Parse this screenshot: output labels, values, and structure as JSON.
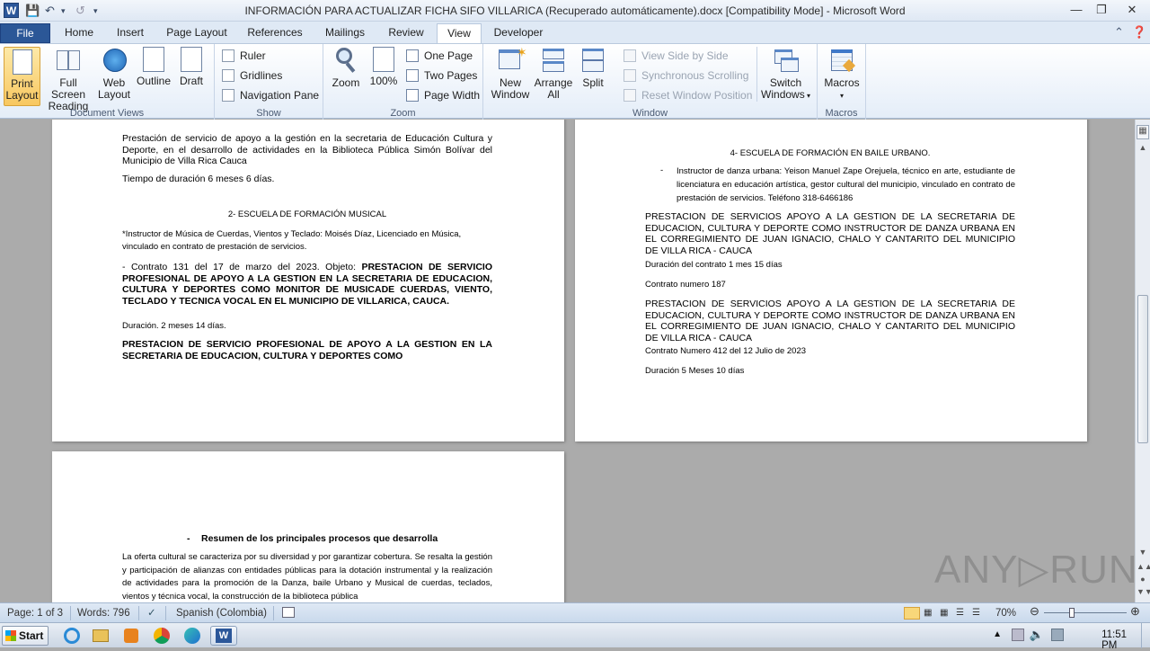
{
  "window": {
    "title": "INFORMACIÓN PARA ACTUALIZAR FICHA SIFO VILLARICA (Recuperado automáticamente).docx [Compatibility Mode] - Microsoft Word",
    "app_icon": "W"
  },
  "tabs": [
    "File",
    "Home",
    "Insert",
    "Page Layout",
    "References",
    "Mailings",
    "Review",
    "View",
    "Developer"
  ],
  "ribbon": {
    "document_views": {
      "label": "Document Views",
      "print_layout": "Print Layout",
      "full_screen_reading": "Full Screen Reading",
      "web_layout": "Web Layout",
      "outline": "Outline",
      "draft": "Draft"
    },
    "show": {
      "label": "Show",
      "ruler": "Ruler",
      "gridlines": "Gridlines",
      "navigation_pane": "Navigation Pane"
    },
    "zoom": {
      "label": "Zoom",
      "zoom": "Zoom",
      "hundred": "100%",
      "one_page": "One Page",
      "two_pages": "Two Pages",
      "page_width": "Page Width"
    },
    "window": {
      "label": "Window",
      "new_window": "New Window",
      "arrange_all": "Arrange All",
      "split": "Split",
      "view_side_by_side": "View Side by Side",
      "synchronous_scrolling": "Synchronous Scrolling",
      "reset_window_position": "Reset Window Position",
      "switch_windows": "Switch Windows"
    },
    "macros": {
      "label": "Macros",
      "macros": "Macros"
    }
  },
  "page1": {
    "p1": "Prestación de servicio de apoyo a la gestión en la secretaria de Educación Cultura y Deporte, en el desarrollo de actividades en la Biblioteca Pública Simón Bolívar del Municipio de Villa Rica Cauca",
    "p2": "Tiempo de duración 6 meses 6 días.",
    "heading": "2- ESCUELA DE FORMACIÓN MUSICAL",
    "p3": "*Instructor de Música de Cuerdas, Vientos y Teclado: Moisés Díaz, Licenciado en Música, vinculado en contrato de prestación de servicios.",
    "p4_normal": "- Contrato 131 del 17 de marzo del 2023. Objeto: ",
    "p4_bold": "PRESTACION DE SERVICIO PROFESIONAL DE APOYO A LA GESTION EN LA SECRETARIA DE EDUCACION, CULTURA Y DEPORTES COMO MONITOR DE MUSICADE CUERDAS, VIENTO, TECLADO Y TECNICA VOCAL EN EL MUNICIPIO DE VILLARICA, CAUCA.",
    "p5": "Duración. 2 meses 14 días.",
    "p6": "PRESTACION DE SERVICIO PROFESIONAL DE APOYO A LA GESTION EN LA SECRETARIA DE EDUCACION, CULTURA Y DEPORTES COMO"
  },
  "page2": {
    "heading": "4- ESCUELA DE FORMACIÓN EN BAILE URBANO.",
    "bullet_dash": "-",
    "bullet": "Instructor de danza urbana: Yeison Manuel Zape Orejuela, técnico en arte, estudiante de licenciatura en educación artística, gestor cultural del municipio, vinculado en contrato de prestación de servicios. Teléfono 318-6466186",
    "p1": "PRESTACION DE SERVICIOS APOYO A LA GESTION DE LA SECRETARIA DE EDUCACION, CULTURA Y DEPORTE COMO INSTRUCTOR DE DANZA URBANA EN EL CORREGIMIENTO DE JUAN IGNACIO, CHALO Y CANTARITO DEL MUNICIPIO DE VILLA RICA - CAUCA",
    "p2": "Duración del contrato 1 mes 15 días",
    "p3": "Contrato numero 187",
    "p4": "PRESTACION DE SERVICIOS APOYO A LA GESTION DE LA SECRETARIA DE EDUCACION, CULTURA Y DEPORTE COMO INSTRUCTOR DE DANZA URBANA EN EL CORREGIMIENTO DE JUAN IGNACIO, CHALO Y CANTARITO DEL MUNICIPIO DE VILLA RICA - CAUCA",
    "p5": "Contrato Numero 412 del 12 Julio de 2023",
    "p6": "Duración 5 Meses 10 días"
  },
  "page3": {
    "heading_dash": "-",
    "heading": "Resumen de los principales procesos que desarrolla",
    "p1": "La oferta cultural se caracteriza por su diversidad y por garantizar cobertura. Se resalta la gestión y participación de alianzas con entidades públicas para la dotación instrumental y la realización de actividades para la promoción de la Danza, baile Urbano y Musical de cuerdas, teclados, vientos y técnica vocal, la construcción de la biblioteca pública"
  },
  "status": {
    "page": "Page: 1 of 3",
    "words": "Words: 796",
    "language": "Spanish (Colombia)",
    "zoom": "70%",
    "zoom_level": 0.7
  },
  "taskbar": {
    "start": "Start",
    "time": "11:51 PM"
  },
  "watermark": "ANY▷RUN",
  "colors": {
    "accent": "#2b5797",
    "ribbon_bg": "#e4edf8",
    "active_button": "#f8c760"
  }
}
